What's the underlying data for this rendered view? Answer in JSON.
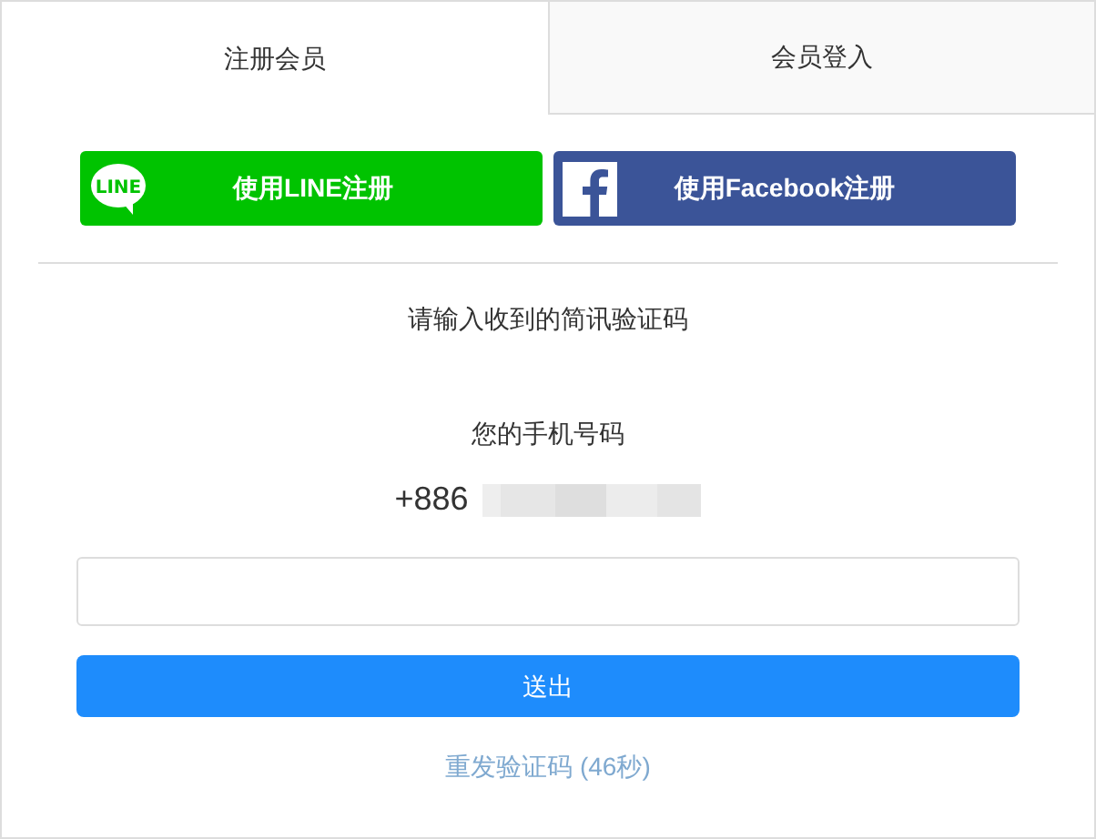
{
  "tabs": [
    {
      "label": "注册会员",
      "selected": true
    },
    {
      "label": "会员登入",
      "selected": false
    }
  ],
  "social_buttons": [
    {
      "kind": "line",
      "label": "使用LINE注册",
      "icon_text": "LINE"
    },
    {
      "kind": "facebook",
      "label": "使用Facebook注册"
    }
  ],
  "instruction": "请输入收到的简讯验证码",
  "phone": {
    "label": "您的手机号码",
    "country_code": "+886"
  },
  "submit": "送出",
  "resend": {
    "label": "重发验证码 (46秒)",
    "disabled": true
  }
}
